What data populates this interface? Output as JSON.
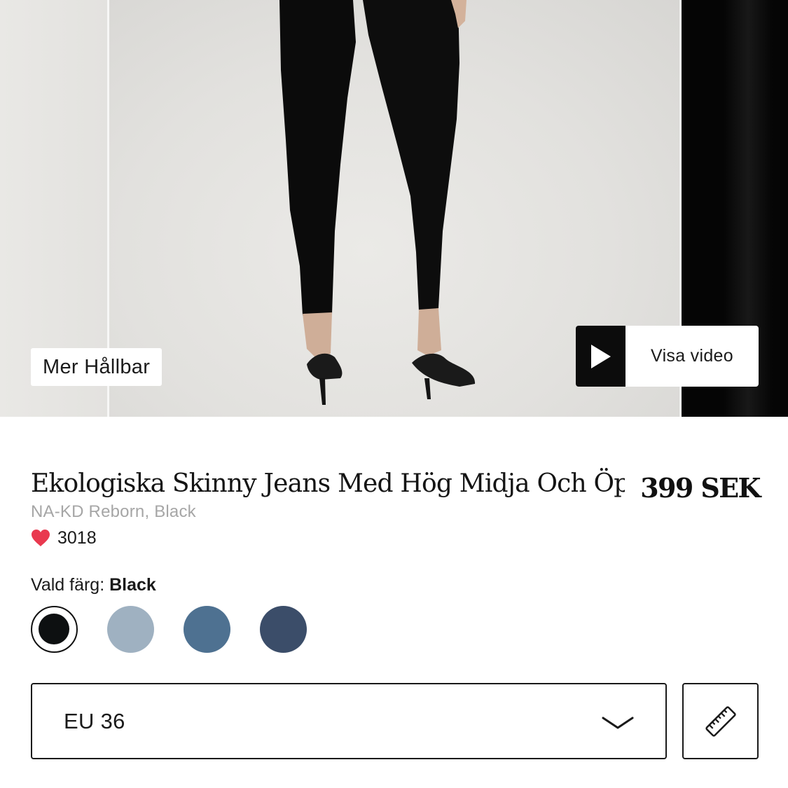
{
  "gallery": {
    "badge_label": "Mer Hållbar",
    "video_label": "Visa video"
  },
  "product": {
    "title": "Ekologiska Skinny Jeans Med Hög Midja Och Öppen",
    "price": "399 SEK",
    "subtitle": "NA-KD Reborn, Black",
    "likes": "3018",
    "like_color": "#e9394f"
  },
  "color_selector": {
    "label": "Vald färg:",
    "selected": "Black",
    "swatches": [
      {
        "color": "#0d1011",
        "selected": true
      },
      {
        "color": "#9fb1c1",
        "selected": false
      },
      {
        "color": "#4e7191",
        "selected": false
      },
      {
        "color": "#3b4d69",
        "selected": false
      }
    ]
  },
  "size_selector": {
    "value": "EU 36"
  },
  "icons": {
    "play": "play-icon",
    "chevron": "chevron-down-icon",
    "ruler": "ruler-icon",
    "heart": "heart-icon"
  }
}
